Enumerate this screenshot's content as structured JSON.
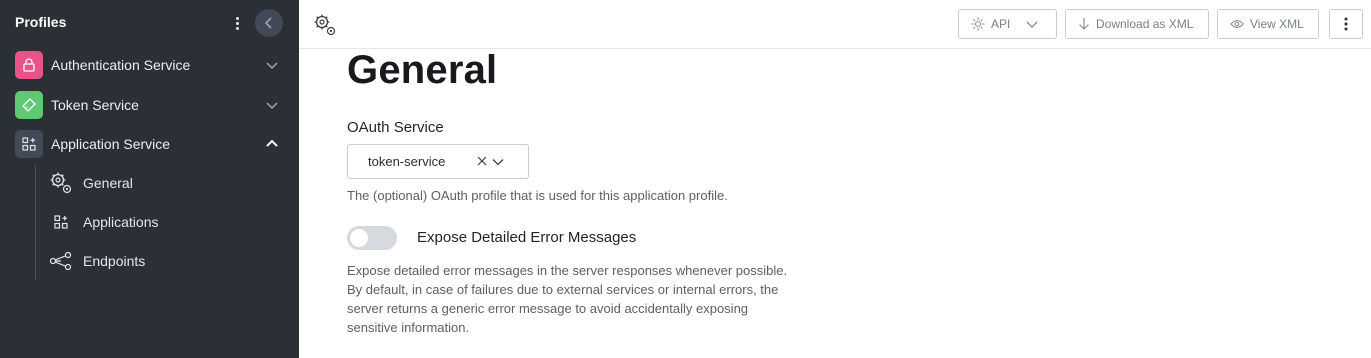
{
  "sidebar": {
    "title": "Profiles",
    "items": [
      {
        "label": "Authentication Service",
        "color": "#e8548a",
        "icon": "lock-icon",
        "expanded": false
      },
      {
        "label": "Token Service",
        "color": "#5fc873",
        "icon": "ticket-icon",
        "expanded": false
      },
      {
        "label": "Application Service",
        "color": "#424957",
        "icon": "apps-icon",
        "expanded": true
      }
    ],
    "subitems": [
      {
        "label": "General",
        "icon": "gears-icon"
      },
      {
        "label": "Applications",
        "icon": "apps-icon"
      },
      {
        "label": "Endpoints",
        "icon": "share-icon"
      }
    ]
  },
  "toolbar": {
    "api_label": "API",
    "download_label": "Download as XML",
    "view_label": "View XML"
  },
  "main": {
    "title": "General",
    "oauth": {
      "label": "OAuth Service",
      "value": "token-service",
      "help": "The (optional) OAuth profile that is used for this application profile."
    },
    "error_toggle": {
      "label": "Expose Detailed Error Messages",
      "enabled": false,
      "help": [
        "Expose detailed error messages in the server responses whenever possible.",
        "By default, in case of failures due to external services or internal errors, the",
        "server returns a generic error message to avoid accidentally exposing",
        "sensitive information."
      ]
    }
  }
}
